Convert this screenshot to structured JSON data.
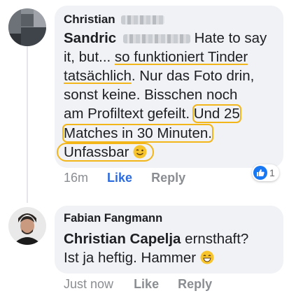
{
  "comment1": {
    "author": "Christian",
    "mention": "Sandric",
    "text_after_mention": " Hate to say",
    "line2_pre": "it, but... ",
    "line2_link": "so funktioniert Tinder",
    "line3_link": "tatsächlich",
    "line3_rest": ". Nur das Foto drin,",
    "line4": "sonst keine. Bisschen noch",
    "line5_pre": "am Profiltext gefeilt. ",
    "line5_hl": "Und 25",
    "line6_hl": "Matches in 30 Minuten.",
    "line7": "Unfassbar",
    "line7_emoji": "wink-emoji",
    "time": "16m",
    "like": "Like",
    "reply": "Reply",
    "reaction_icon": "thumbs-up-icon",
    "reaction_count": "1"
  },
  "comment2": {
    "author": "Fabian Fangmann",
    "mention": "Christian Capelja",
    "line1_rest": " ernsthaft?",
    "line2": "Ist ja heftig. Hammer",
    "line2_emoji": "grin-emoji",
    "time": "Just now",
    "like": "Like",
    "reply": "Reply"
  },
  "colors": {
    "bubble": "#f0f2f5",
    "highlight": "#f2b51a",
    "like_active": "#2d6cdf",
    "meta": "#8a8d91",
    "reaction_badge": "#1877f2"
  }
}
